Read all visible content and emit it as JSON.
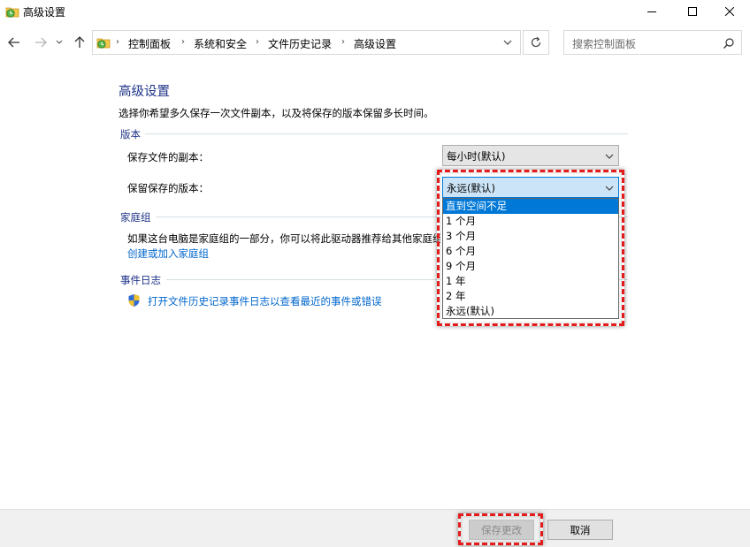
{
  "window": {
    "title": "高级设置"
  },
  "address_bar": {
    "breadcrumbs": [
      "控制面板",
      "系统和安全",
      "文件历史记录",
      "高级设置"
    ]
  },
  "search": {
    "placeholder": "搜索控制面板"
  },
  "main": {
    "title": "高级设置",
    "description": "选择你希望多久保存一次文件副本，以及将保存的版本保留多长时间。",
    "versions_group": {
      "label": "版本",
      "save_copies_label": "保存文件的副本：",
      "save_copies_value": "每小时(默认)",
      "keep_versions_label": "保留保存的版本：",
      "keep_versions_value": "永远(默认)",
      "keep_versions_options": [
        "直到空间不足",
        "1 个月",
        "3 个月",
        "6 个月",
        "9 个月",
        "1 年",
        "2 年",
        "永远(默认)"
      ],
      "highlighted_option": "直到空间不足"
    },
    "homegroup_group": {
      "label": "家庭组",
      "text": "如果这台电脑是家庭组的一部分，你可以将此驱动器推荐给其他家庭组成员。",
      "link": "创建或加入家庭组"
    },
    "eventlog_group": {
      "label": "事件日志",
      "link": "打开文件历史记录事件日志以查看最近的事件或错误"
    }
  },
  "footer": {
    "save_label": "保存更改",
    "cancel_label": "取消"
  },
  "colors": {
    "heading": "#1e3287",
    "link": "#0066cc",
    "selection": "#0078d7",
    "annotation": "#e41b1b"
  }
}
